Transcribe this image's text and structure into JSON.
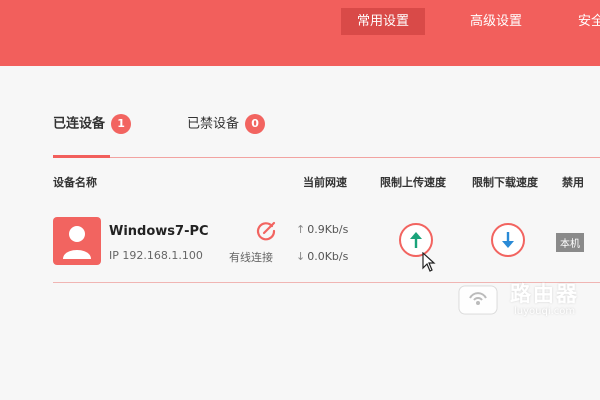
{
  "top_nav": {
    "items": [
      {
        "label": "常用设置",
        "active": true
      },
      {
        "label": "高级设置",
        "active": false
      },
      {
        "label": "安全",
        "active": false
      }
    ]
  },
  "device_tabs": {
    "connected": {
      "label": "已连设备",
      "count": "1"
    },
    "banned": {
      "label": "已禁设备",
      "count": "0"
    }
  },
  "table": {
    "headers": {
      "name": "设备名称",
      "current_speed": "当前网速",
      "limit_upload": "限制上传速度",
      "limit_download": "限制下载速度",
      "ban": "禁用"
    },
    "rows": [
      {
        "device_name": "Windows7-PC",
        "ip": "IP 192.168.1.100",
        "connection": "有线连接",
        "upload_speed": "0.9Kb/s",
        "download_speed": "0.0Kb/s",
        "ban_tag": "本机"
      }
    ]
  },
  "icons": {
    "avatar": "user-icon",
    "edit": "edit-icon",
    "upload": "arrow-up-icon",
    "download": "arrow-down-icon"
  },
  "watermark": {
    "title": "路由器",
    "url": "luyouqi.com"
  },
  "colors": {
    "brand": "#f25f5c",
    "brand_dark": "#d94a48",
    "upload_arrow": "#1aa37a",
    "download_arrow": "#2a8ad6"
  }
}
